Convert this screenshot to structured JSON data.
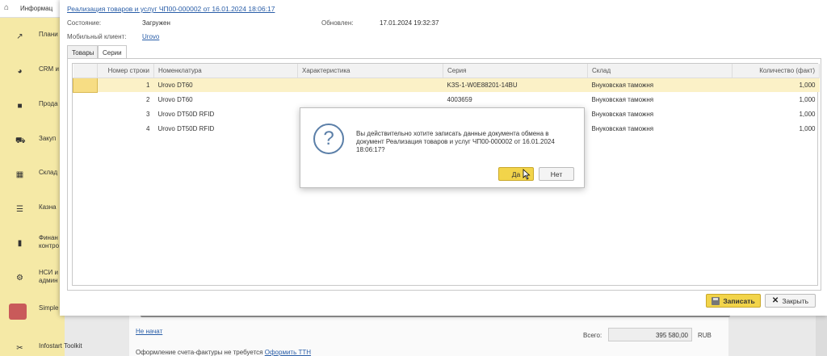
{
  "sidebar": {
    "top_label": "Информац",
    "items": [
      {
        "label": "Плани",
        "icon": "chart-icon"
      },
      {
        "label": "CRM и",
        "icon": "pie-chart-icon"
      },
      {
        "label": "Прода",
        "icon": "briefcase-icon"
      },
      {
        "label": "Закуп",
        "icon": "cart-icon"
      },
      {
        "label": "Склад",
        "icon": "grid-icon"
      },
      {
        "label": "Казна",
        "icon": "list-icon"
      },
      {
        "label": "Финан\nконтро",
        "icon": "bar-chart-icon"
      },
      {
        "label": "НСИ и\nадмин",
        "icon": "gear-icon"
      },
      {
        "label": "Simple",
        "icon": "simple-logo"
      },
      {
        "label": "Infostart Toolkit",
        "icon": "tools-icon"
      }
    ]
  },
  "document": {
    "title_link": "Реализация товаров и услуг ЧП00-000002 от 16.01.2024 18:06:17",
    "state_label": "Состояние:",
    "state_value": "Загружен",
    "updated_label": "Обновлен:",
    "updated_value": "17.01.2024 19:32:37",
    "client_label": "Мобильный клиент:",
    "client_value": "Urovo"
  },
  "tabs": [
    {
      "label": "Товары",
      "active": false
    },
    {
      "label": "Серии",
      "active": true
    }
  ],
  "table": {
    "columns": [
      "Номер строки",
      "Номенклатура",
      "Характеристика",
      "Серия",
      "Склад",
      "Количество (факт)"
    ],
    "rows": [
      {
        "num": "1",
        "item": "Urovo DT60",
        "char": "",
        "series": "K3S-1-W0E88201-14BU",
        "warehouse": "Внуковская таможня",
        "qty": "1,000"
      },
      {
        "num": "2",
        "item": "Urovo DT60",
        "char": "",
        "series": "4003659",
        "warehouse": "Внуковская таможня",
        "qty": "1,000"
      },
      {
        "num": "3",
        "item": "Urovo DT50D RFID",
        "char": "",
        "series": "",
        "warehouse": "Внуковская таможня",
        "qty": "1,000"
      },
      {
        "num": "4",
        "item": "Urovo DT50D RFID",
        "char": "",
        "series": "",
        "warehouse": "Внуковская таможня",
        "qty": "1,000"
      }
    ]
  },
  "buttons": {
    "save": "Записать",
    "close": "Закрыть"
  },
  "dialog": {
    "message": "Вы действительно хотите записать данные документа обмена в документ Реализация товаров и услуг ЧП00-000002 от 16.01.2024 18:06:17?",
    "yes": "Да",
    "no": "Нет"
  },
  "background": {
    "status_link": "Не начат",
    "total_label": "Всего:",
    "total_value": "395 580,00",
    "currency": "RUB",
    "invoice_text": "Оформление счета-фактуры не требуется",
    "invoice_link": "Оформить ТТН"
  },
  "colors": {
    "sidebar_bg": "#f5e9a6",
    "accent_yellow": "#f2d44a",
    "link_blue": "#2a5ea8",
    "selected_row": "#fbf1c7"
  }
}
